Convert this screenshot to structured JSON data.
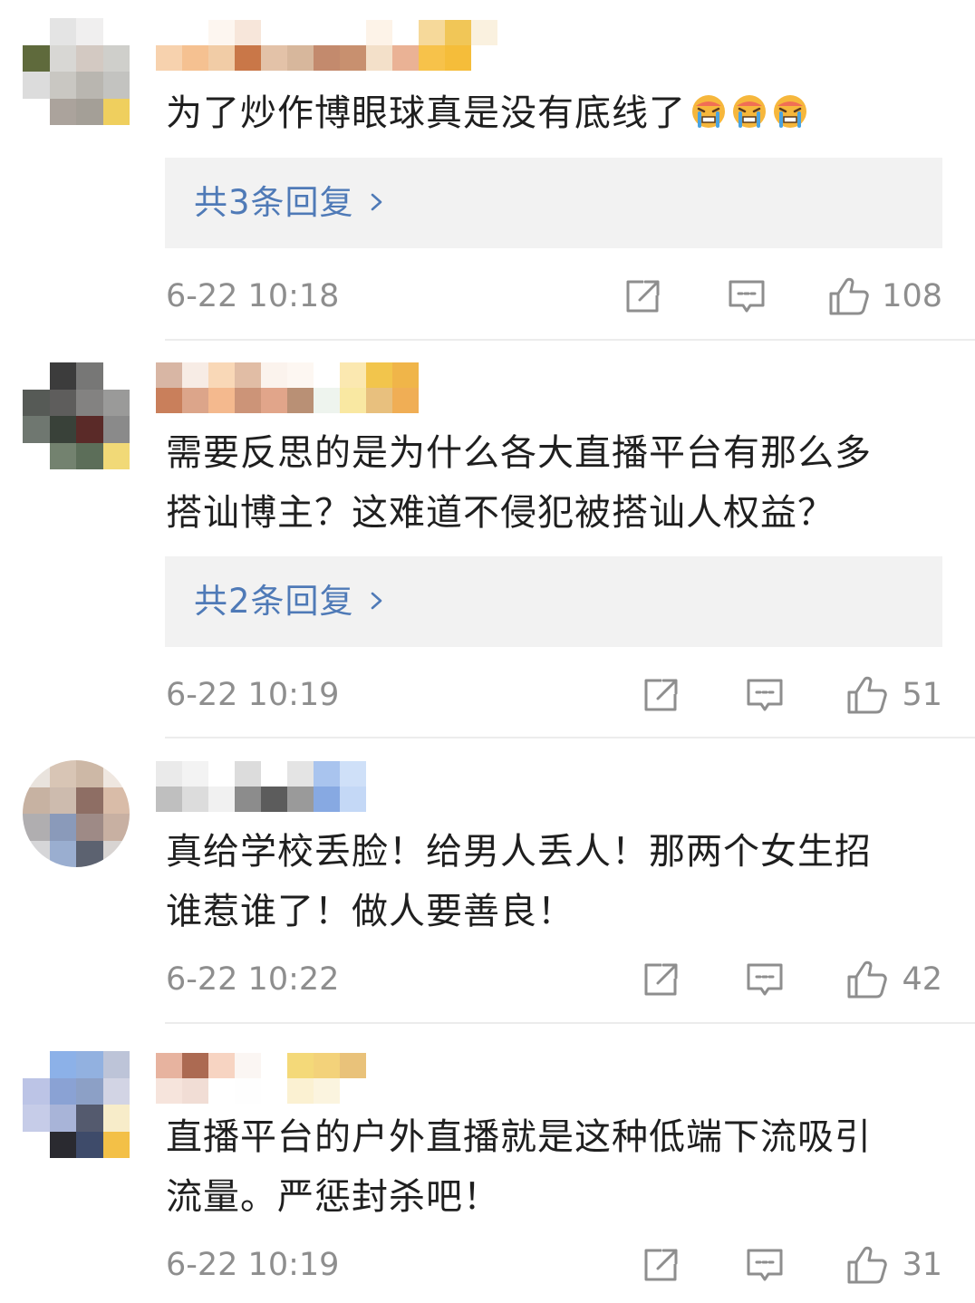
{
  "comments": [
    {
      "text": "为了炒作博眼球真是没有底线了",
      "emoji": [
        "sob-icon",
        "sob-icon",
        "sob-icon"
      ],
      "replies_label": "共3条回复",
      "time": "6-22 10:18",
      "likes": "108"
    },
    {
      "text": "需要反思的是为什么各大直播平台有那么多\n搭讪博主？这难道不侵犯被搭讪人权益？",
      "replies_label": "共2条回复",
      "time": "6-22 10:19",
      "likes": "51"
    },
    {
      "text": "真给学校丢脸！给男人丢人！那两个女生招\n谁惹谁了！做人要善良！",
      "time": "6-22 10:22",
      "likes": "42"
    },
    {
      "text": "直播平台的户外直播就是这种低端下流吸引\n流量。严惩封杀吧！",
      "time": "6-22 10:19",
      "likes": "31"
    }
  ],
  "colors": {
    "reply_link": "#4f7ab7",
    "meta_text": "#8e8e8e",
    "reply_box": "#f2f2f2"
  }
}
